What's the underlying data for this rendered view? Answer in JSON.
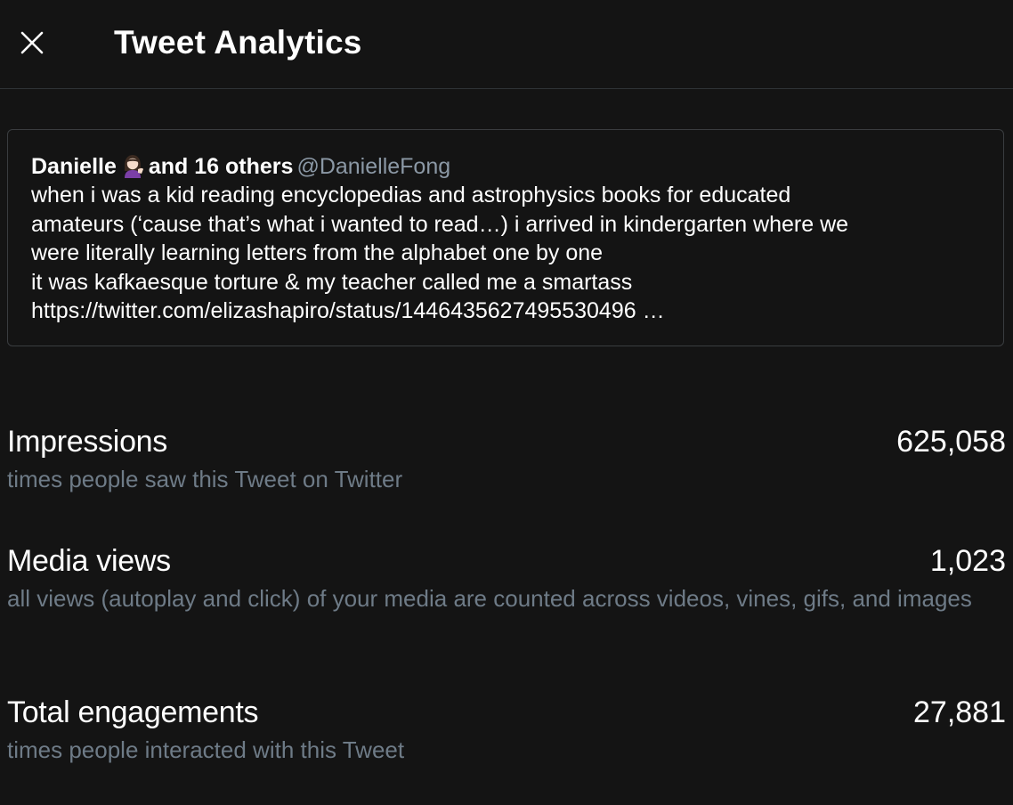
{
  "header": {
    "title": "Tweet Analytics",
    "close_icon": "close-icon"
  },
  "tweet": {
    "author_name": "Danielle",
    "author_emoji": "woman-tipping-hand-emoji",
    "author_suffix": "and 16 others",
    "handle": "@DanielleFong",
    "lines": [
      "when i was a kid reading encyclopedias and astrophysics books for educated",
      "amateurs (‘cause that’s what i wanted to read…) i arrived in kindergarten where we",
      "were literally learning letters from the alphabet one by one",
      "it was kafkaesque torture & my teacher called me a smartass",
      "https://twitter.com/elizashapiro/status/1446435627495530496 …"
    ]
  },
  "metrics": [
    {
      "label": "Impressions",
      "value": "625,058",
      "description": "times people saw this Tweet on Twitter"
    },
    {
      "label": "Media views",
      "value": "1,023",
      "description": "all views (autoplay and click) of your media are counted across videos, vines, gifs, and images"
    },
    {
      "label": "Total engagements",
      "value": "27,881",
      "description": "times people interacted with this Tweet"
    }
  ],
  "colors": {
    "background": "#141414",
    "text": "#ffffff",
    "secondary": "#6e7b87",
    "handle": "#8b98a5",
    "border": "#3a3d40"
  }
}
